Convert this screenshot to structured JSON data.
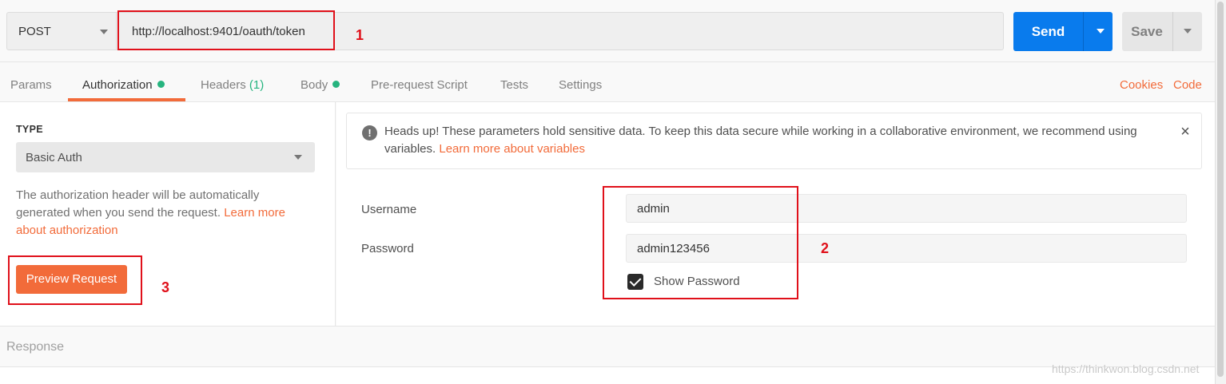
{
  "request": {
    "method": "POST",
    "url": "http://localhost:9401/oauth/token",
    "send_label": "Send",
    "save_label": "Save"
  },
  "tabs": [
    {
      "label": "Params"
    },
    {
      "label": "Authorization",
      "indicator": "dot"
    },
    {
      "label": "Headers",
      "count": "(1)"
    },
    {
      "label": "Body",
      "indicator": "dot"
    },
    {
      "label": "Pre-request Script"
    },
    {
      "label": "Tests"
    },
    {
      "label": "Settings"
    }
  ],
  "right_links": {
    "cookies": "Cookies",
    "code": "Code"
  },
  "auth": {
    "type_label": "TYPE",
    "type_value": "Basic Auth",
    "description": "The authorization header will be automatically generated when you send the request.",
    "learn_link": "Learn more about authorization",
    "preview_button": "Preview Request"
  },
  "alert": {
    "text": "Heads up! These parameters hold sensitive data. To keep this data secure while working in a collaborative environment, we recommend using variables.",
    "link": "Learn more about variables"
  },
  "form": {
    "username_label": "Username",
    "username_value": "admin",
    "password_label": "Password",
    "password_value": "admin123456",
    "show_password_label": "Show Password",
    "show_password_checked": true
  },
  "response": {
    "label": "Response"
  },
  "annotations": {
    "one": "1",
    "two": "2",
    "three": "3"
  },
  "watermark": "https://thinkwon.blog.csdn.net",
  "colors": {
    "accent": "#f26b3a",
    "send": "#097bed",
    "green": "#26b47f",
    "annotation": "#e0101a"
  },
  "icons": {
    "alert": "exclamation-circle-icon",
    "close": "close-icon",
    "caret": "chevron-down-icon",
    "check": "checkmark-icon"
  }
}
